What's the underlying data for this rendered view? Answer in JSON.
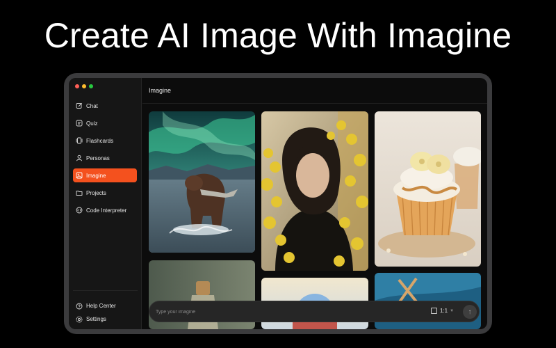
{
  "headline": "Create AI Image With Imagine",
  "window": {
    "traffic_lights": [
      {
        "name": "close",
        "color": "#ff5f57"
      },
      {
        "name": "minimize",
        "color": "#febc2e"
      },
      {
        "name": "zoom",
        "color": "#28c840"
      }
    ]
  },
  "sidebar": {
    "items": [
      {
        "label": "Chat",
        "icon": "edit-icon"
      },
      {
        "label": "Quiz",
        "icon": "quiz-icon"
      },
      {
        "label": "Flashcards",
        "icon": "flashcards-icon"
      },
      {
        "label": "Personas",
        "icon": "person-icon"
      },
      {
        "label": "Imagine",
        "icon": "image-icon",
        "active": true
      },
      {
        "label": "Projects",
        "icon": "folder-icon"
      },
      {
        "label": "Code Interpreter",
        "icon": "code-icon"
      }
    ],
    "bottom_items": [
      {
        "label": "Help Center",
        "icon": "help-icon"
      },
      {
        "label": "Settings",
        "icon": "gear-icon"
      }
    ]
  },
  "main": {
    "title": "Imagine",
    "gallery": [
      {
        "subject": "bear-salmon-aurora"
      },
      {
        "subject": "woman-yellow-flowers"
      },
      {
        "subject": "banana-cupcake"
      },
      {
        "subject": "bottle"
      },
      {
        "subject": "balloon-sky"
      },
      {
        "subject": "blue-abstract"
      }
    ]
  },
  "composer": {
    "placeholder": "Type your imagine",
    "aspect_ratio": "1:1"
  },
  "colors": {
    "accent": "#f4511e",
    "background": "#000000",
    "sidebar": "#161616"
  }
}
